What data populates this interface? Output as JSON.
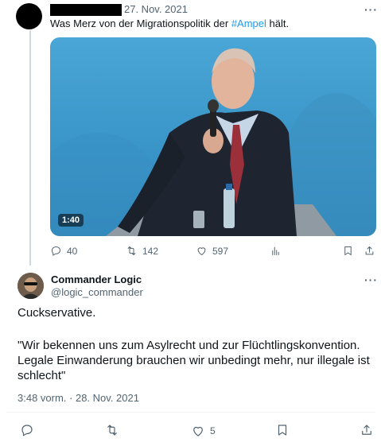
{
  "parent_tweet": {
    "date": "27. Nov. 2021",
    "text_before": "Was Merz von der Migrationspolitik der ",
    "hashtag": "#Ampel",
    "text_after": " hält.",
    "video_duration": "1:40",
    "stats": {
      "replies": "40",
      "retweets": "142",
      "likes": "597"
    }
  },
  "main_tweet": {
    "display_name": "Commander Logic",
    "handle": "@logic_commander",
    "line1": "Cuckservative.",
    "line2": "\"Wir bekennen uns zum Asylrecht und zur Flüchtlingskonvention.",
    "line3": "Legale Einwanderung brauchen wir unbedingt mehr, nur illegale ist",
    "line4": "schlecht\"",
    "timestamp": "3:48 vorm. · 28. Nov. 2021",
    "likes": "5"
  },
  "more_label": "···",
  "icons": [
    "reply-icon",
    "retweet-icon",
    "like-icon",
    "views-icon",
    "bookmark-icon",
    "share-icon"
  ],
  "colors": {
    "accent": "#1d9bf0",
    "muted": "#536471",
    "text": "#0f1419"
  }
}
